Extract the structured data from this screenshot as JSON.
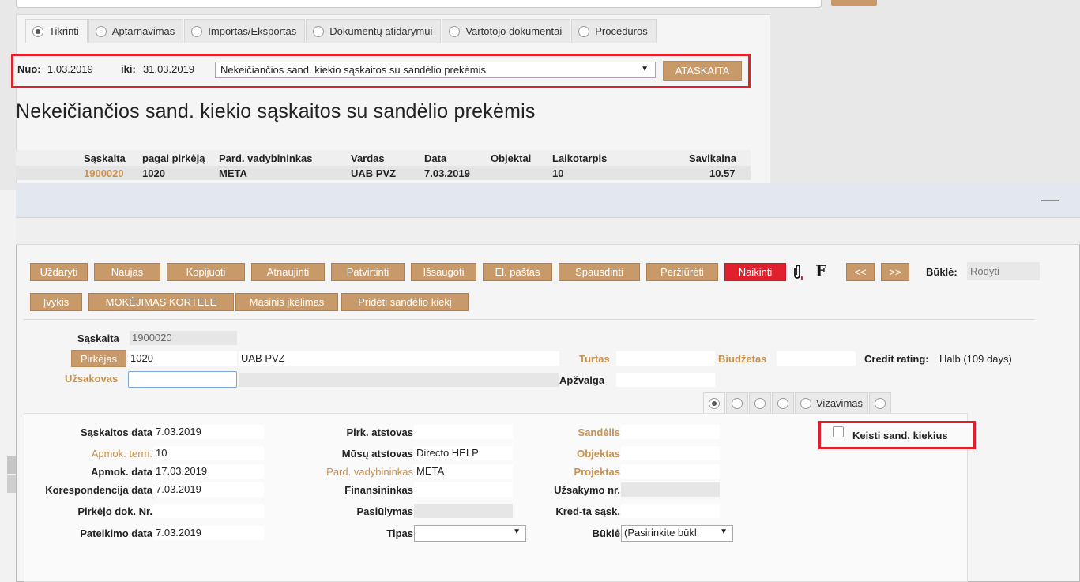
{
  "background": {
    "tabs": [
      {
        "label": "Tikrinti",
        "active": true
      },
      {
        "label": "Aptarnavimas",
        "active": false
      },
      {
        "label": "Importas/Eksportas",
        "active": false
      },
      {
        "label": "Dokumentų atidarymui",
        "active": false
      },
      {
        "label": "Vartotojo dokumentai",
        "active": false
      },
      {
        "label": "Procedūros",
        "active": false
      }
    ],
    "filter": {
      "from_label": "Nuo:",
      "from_value": "1.03.2019",
      "to_label": "iki:",
      "to_value": "31.03.2019",
      "report_select": "Nekeičiančios sand. kiekio sąskaitos su sandėlio prekėmis",
      "report_button": "ATASKAITA"
    },
    "report_title": "Nekeičiančios sand. kiekio sąskaitos su sandėlio prekėmis",
    "table": {
      "headers": [
        "Sąskaita",
        "pagal pirkėją",
        "Pard. vadybininkas",
        "Vardas",
        "Data",
        "Objektai",
        "Laikotarpis",
        "Savikaina"
      ],
      "rows": [
        [
          "1900020",
          "1020",
          "META",
          "UAB PVZ",
          "7.03.2019",
          "",
          "10",
          "10.57"
        ]
      ]
    }
  },
  "modal": {
    "minimize": "—",
    "toolbar_row1": [
      "Uždaryti",
      "Naujas",
      "Kopijuoti",
      "Atnaujinti",
      "Patvirtinti",
      "Išsaugoti",
      "El. paštas",
      "Spausdinti",
      "Peržiūrėti",
      "Naikinti"
    ],
    "toolbar_row2": [
      "Įvykis",
      "MOKĖJIMAS KORTELE",
      "Masinis įkėlimas",
      "Pridėti sandėlio kiekį"
    ],
    "f_icon": "F",
    "prev_button": "<<",
    "next_button": ">>",
    "status_label": "Būklė:",
    "status_value": "Rodyti",
    "header": {
      "saskaita_label": "Sąskaita",
      "saskaita_value": "1900020",
      "pirkejas_button": "Pirkėjas",
      "pirkejas_code": "1020",
      "pirkejas_name": "UAB PVZ",
      "turtas_label": "Turtas",
      "biudzetas_label": "Biudžetas",
      "credit_label": "Credit rating:",
      "credit_value": "Halb (109 days)",
      "uzsakovas_label": "Užsakovas",
      "apzvalga_label": "Apžvalga"
    },
    "tabs2": [
      {
        "label": "",
        "active": true
      },
      {
        "label": "",
        "active": false
      },
      {
        "label": "",
        "active": false
      },
      {
        "label": "",
        "active": false
      },
      {
        "label": "Vizavimas",
        "active": false
      },
      {
        "label": "",
        "active": false
      }
    ],
    "details": {
      "col1": [
        {
          "label": "Sąskaitos data",
          "value": "7.03.2019",
          "link": false
        },
        {
          "label": "Apmok. term.",
          "value": "10",
          "link": true
        },
        {
          "label": "Apmok. data",
          "value": "17.03.2019",
          "link": false
        },
        {
          "label": "Korespondencija data",
          "value": "7.03.2019",
          "link": false
        },
        {
          "label": "Pirkėjo dok. Nr.",
          "value": "",
          "link": false
        },
        {
          "label": "Pateikimo data",
          "value": "7.03.2019",
          "link": false
        }
      ],
      "col2": [
        {
          "label": "Pirk. atstovas",
          "value": "",
          "link": false
        },
        {
          "label": "Mūsų atstovas",
          "value": "Directo HELP",
          "link": false
        },
        {
          "label": "Pard. vadybininkas",
          "value": "META",
          "link": true
        },
        {
          "label": "Finansininkas",
          "value": "",
          "link": false
        },
        {
          "label": "Pasiūlymas",
          "value": "",
          "link": false
        },
        {
          "label": "Tipas",
          "value": "",
          "link": false
        }
      ],
      "col3": [
        {
          "label": "Sandėlis",
          "value": "",
          "link": true
        },
        {
          "label": "Objektas",
          "value": "",
          "link": true
        },
        {
          "label": "Projektas",
          "value": "",
          "link": true
        },
        {
          "label": "Užsakymo nr.",
          "value": "",
          "link": false
        },
        {
          "label": "Kred-ta sąsk.",
          "value": "",
          "link": false
        },
        {
          "label": "Būklė",
          "value": "(Pasirinkite būkl",
          "link": false
        }
      ]
    },
    "checkbox_label": "Keisti sand. kiekius"
  },
  "colors": {
    "accent_button": "#c89a6a",
    "danger": "#e0212d",
    "link": "#c8914f"
  }
}
